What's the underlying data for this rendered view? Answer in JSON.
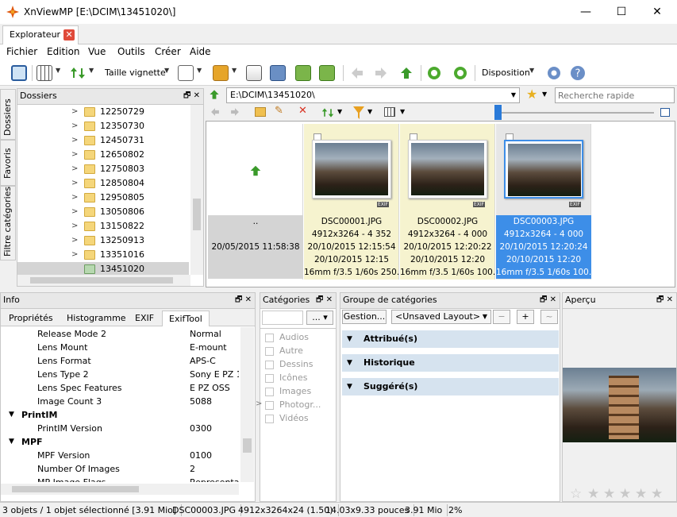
{
  "window": {
    "title": "XnViewMP [E:\\DCIM\\13451020\\]",
    "minimize": "—",
    "maximize": "☐",
    "close": "✕"
  },
  "tabs": [
    {
      "label": "Explorateur",
      "close": "✕"
    }
  ],
  "menu": [
    "Fichier",
    "Edition",
    "Vue",
    "Outils",
    "Créer",
    "Aide"
  ],
  "toolbar": {
    "thumb_size_label": "Taille vignette",
    "layout_label": "Disposition"
  },
  "folders_panel": {
    "title": "Dossiers",
    "side_tabs": [
      "Dossiers",
      "Favoris",
      "Filtre catégories"
    ],
    "items": [
      "12250729",
      "12350730",
      "12450731",
      "12650802",
      "12750803",
      "12850804",
      "12950805",
      "13050806",
      "13150822",
      "13250913",
      "13351016",
      "13451020"
    ]
  },
  "address": {
    "path": "E:\\DCIM\\13451020\\",
    "search_placeholder": "Recherche rapide"
  },
  "thumbs": {
    "parent": {
      "label": "..",
      "date": "20/05/2015 11:58:38"
    },
    "items": [
      {
        "name": "DSC00001.JPG",
        "dims": "4912x3264 - 4 352",
        "date1": "20/10/2015 12:15:54",
        "date2": "20/10/2015 12:15",
        "exif": "16mm f/3.5 1/60s 250...",
        "selected": false
      },
      {
        "name": "DSC00002.JPG",
        "dims": "4912x3264 - 4 000",
        "date1": "20/10/2015 12:20:22",
        "date2": "20/10/2015 12:20",
        "exif": "16mm f/3.5 1/60s 100...",
        "selected": false
      },
      {
        "name": "DSC00003.JPG",
        "dims": "4912x3264 - 4 000",
        "date1": "20/10/2015 12:20:24",
        "date2": "20/10/2015 12:20",
        "exif": "16mm f/3.5 1/60s 100...",
        "selected": true
      }
    ]
  },
  "info_panel": {
    "title": "Info",
    "tabs": [
      "Propriétés",
      "Histogramme",
      "EXIF",
      "ExifTool"
    ],
    "rows": [
      {
        "type": "kv",
        "key": "Release Mode 2",
        "val": "Normal"
      },
      {
        "type": "kv",
        "key": "Lens Mount",
        "val": "E-mount"
      },
      {
        "type": "kv",
        "key": "Lens Format",
        "val": "APS-C"
      },
      {
        "type": "kv",
        "key": "Lens Type 2",
        "val": "Sony E PZ 16"
      },
      {
        "type": "kv",
        "key": "Lens Spec Features",
        "val": "E PZ OSS"
      },
      {
        "type": "kv",
        "key": "Image Count 3",
        "val": "5088"
      },
      {
        "type": "group",
        "key": "PrintIM"
      },
      {
        "type": "kv",
        "key": "PrintIM Version",
        "val": "0300"
      },
      {
        "type": "group",
        "key": "MPF"
      },
      {
        "type": "kv",
        "key": "MPF Version",
        "val": "0100"
      },
      {
        "type": "kv",
        "key": "Number Of Images",
        "val": "2"
      },
      {
        "type": "kv",
        "key": "MP Image Flags",
        "val": "Representati"
      }
    ]
  },
  "categories_panel": {
    "title": "Catégories",
    "dropdown": "...",
    "items": [
      "Audios",
      "Autre",
      "Dessins",
      "Icônes",
      "Images",
      "Photogr...",
      "Vidéos"
    ]
  },
  "group_panel": {
    "title": "Groupe de catégories",
    "manage": "Gestion...",
    "layout": "<Unsaved Layout>",
    "rows": [
      "Attribué(s)",
      "Historique",
      "Suggéré(s)"
    ]
  },
  "preview_panel": {
    "title": "Aperçu"
  },
  "status": {
    "selection": "3 objets / 1 objet sélectionné [3.91 Mio]",
    "file": "DSC00003.JPG",
    "dims": "4912x3264x24 (1.50)",
    "size_inches": "14.03x9.33 pouces",
    "file_size": "3.91 Mio",
    "zoom": "2%"
  },
  "colors": {
    "selection": "#3d8ee8",
    "thumb_bg": "#f6f3cf",
    "group_row": "#d6e3ef"
  }
}
